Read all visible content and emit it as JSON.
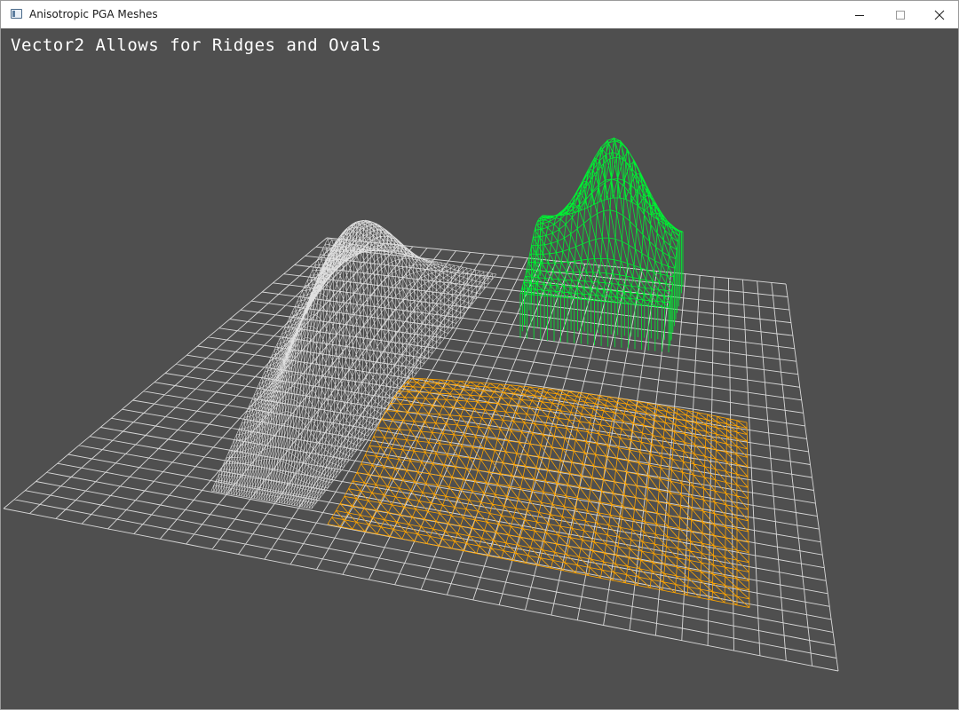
{
  "window": {
    "title": "Anisotropic PGA Meshes",
    "controls": {
      "minimize": "minimize",
      "maximize": "maximize",
      "close": "close"
    }
  },
  "scene": {
    "overlay_text": "Vector2 Allows for Ridges and Ovals",
    "background_color": "#4f4f4f",
    "meshes": [
      {
        "name": "ground-grid",
        "color": "#d8d8d8"
      },
      {
        "name": "ridge-mesh",
        "color": "#e0e0e0"
      },
      {
        "name": "oval-bump-mesh",
        "color": "#00ee33"
      },
      {
        "name": "wave-mesh",
        "color": "#ffa500"
      }
    ]
  }
}
